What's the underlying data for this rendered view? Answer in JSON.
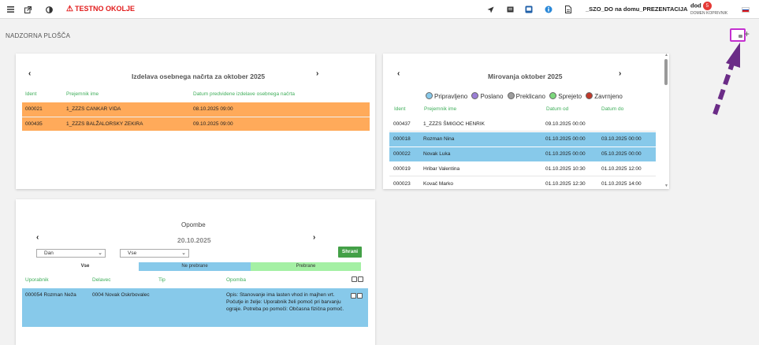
{
  "topbar": {
    "env_title": "TESTNO OKOLJE",
    "warning_icon": "⚠",
    "link_title": "_SZO_DO na domu_PREZENTACIJA",
    "user_name": "dod",
    "user_badge": "5",
    "user_subtitle": "DOMEN KOPRIVNIK",
    "left_icons": [
      "menu-icon",
      "external-link-icon",
      "contrast-icon"
    ],
    "right_icons": [
      "send-icon",
      "card-icon",
      "screen-icon",
      "info-icon",
      "document-icon"
    ],
    "flag_colors": [
      "#ffffff",
      "#1f4aa8",
      "#e21b1b"
    ]
  },
  "page": {
    "title": "NADZORNA PLOŠČA",
    "plus": "+"
  },
  "plans": {
    "title": "Izdelava osebnega načrta za oktober 2025",
    "prev": "‹",
    "next": "›",
    "headers": [
      "Ident",
      "Prejemnik ime",
      "Datum predvidene izdelave osebnega načrta"
    ],
    "rows": [
      [
        "000021",
        "1_ZZZS CANKAR VIDA",
        "08.10.2025 09:00"
      ],
      [
        "000435",
        "1_ZZZS BALŽALORSKY ZEKIRA",
        "09.10.2025 09:00"
      ]
    ],
    "row_color": "#ffaa5a"
  },
  "mirovanja": {
    "title": "Mirovanja oktober 2025",
    "prev": "‹",
    "next": "›",
    "legend": [
      {
        "label": "Pripravljeno",
        "color": "#87c9ea"
      },
      {
        "label": "Poslano",
        "color": "#9b7fd6"
      },
      {
        "label": "Preklicano",
        "color": "#9e9e9e"
      },
      {
        "label": "Sprejeto",
        "color": "#7cd87c"
      },
      {
        "label": "Zavrnjeno",
        "color": "#c0392b"
      }
    ],
    "headers": [
      "Ident",
      "Prejemnik ime",
      "Datum od",
      "Datum do"
    ],
    "rows": [
      [
        "000437",
        "1_ZZZS ŠMIGOC HENRIK",
        "09.10.2025 00:00",
        ""
      ],
      [
        "000018",
        "Rozman Nina",
        "01.10.2025 00:00",
        "03.10.2025 00:00"
      ],
      [
        "000022",
        "Novak Luka",
        "01.10.2025 00:00",
        "05.10.2025 00:00"
      ],
      [
        "000019",
        "Hribar Valentina",
        "01.10.2025 10:30",
        "01.10.2025 12:00"
      ],
      [
        "000023",
        "Kovač Marko",
        "01.10.2025 12:30",
        "01.10.2025 14:00"
      ]
    ],
    "highlight_color": "#87c9ea"
  },
  "opombe": {
    "title": "Opombe",
    "date": "20.10.2025",
    "prev": "‹",
    "next": "›",
    "select_period": "Dan",
    "select_filter": "Vse",
    "save_label": "Shrani",
    "filters": [
      "Vse",
      "Ne prebrane",
      "Prebrane"
    ],
    "headers": [
      "Uporabnik",
      "Delavec",
      "Tip",
      "Opomba"
    ],
    "row": {
      "user": "000054 Rozman Neža",
      "worker": "0004 Novak Oskrbovalec",
      "note": "Opis: Stanovanje ima lasten vhod in majhen vrt. Počutje in želje: Uporabnik želi pomoč pri barvanju ograje. Potreba po pomoči: Občasna fizična pomoč."
    },
    "row_color": "#87c9ea"
  }
}
